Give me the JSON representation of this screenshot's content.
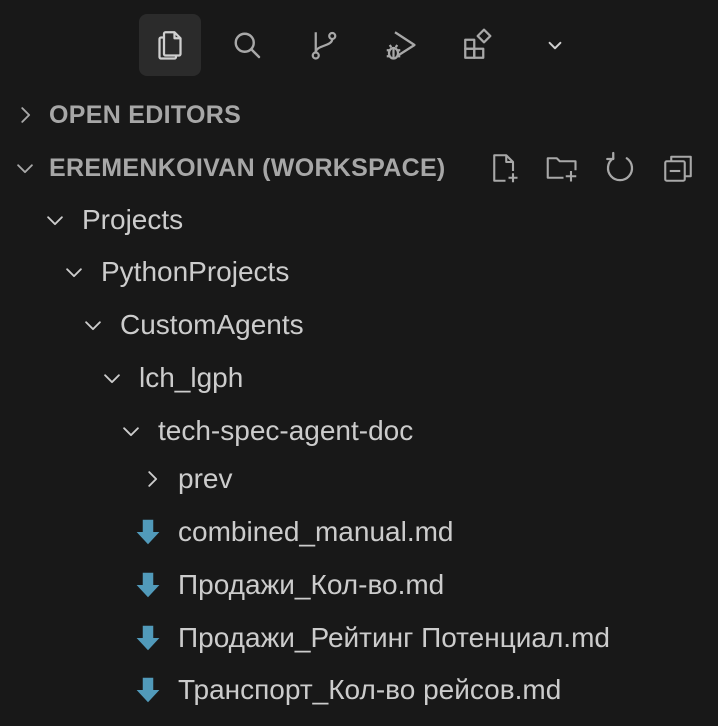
{
  "activity_bar": {
    "items": [
      {
        "name": "explorer",
        "icon": "files-icon",
        "active": true
      },
      {
        "name": "search",
        "icon": "search-icon",
        "active": false
      },
      {
        "name": "source-control",
        "icon": "git-branch-icon",
        "active": false
      },
      {
        "name": "run-and-debug",
        "icon": "run-debug-icon",
        "active": false
      },
      {
        "name": "extensions",
        "icon": "extensions-icon",
        "active": false
      },
      {
        "name": "more",
        "icon": "chevron-down-icon",
        "active": false
      }
    ]
  },
  "sections": {
    "open_editors": {
      "title": "OPEN EDITORS",
      "expanded": false
    },
    "workspace": {
      "title": "EREMENKOIVAN (WORKSPACE)",
      "expanded": true
    }
  },
  "workspace_actions": [
    {
      "name": "new-file",
      "icon": "new-file-icon"
    },
    {
      "name": "new-folder",
      "icon": "new-folder-icon"
    },
    {
      "name": "refresh",
      "icon": "refresh-icon"
    },
    {
      "name": "collapse-all",
      "icon": "collapse-all-icon"
    }
  ],
  "tree": [
    {
      "label": "Projects",
      "type": "folder",
      "expanded": true,
      "depth": 0
    },
    {
      "label": "PythonProjects",
      "type": "folder",
      "expanded": true,
      "depth": 1
    },
    {
      "label": "CustomAgents",
      "type": "folder",
      "expanded": true,
      "depth": 2
    },
    {
      "label": "lch_lgph",
      "type": "folder",
      "expanded": true,
      "depth": 3
    },
    {
      "label": "tech-spec-agent-doc",
      "type": "folder",
      "expanded": true,
      "depth": 4
    },
    {
      "label": "prev",
      "type": "folder",
      "expanded": false,
      "depth": 5
    },
    {
      "label": "combined_manual.md",
      "type": "file",
      "depth": 5
    },
    {
      "label": "Продажи_Кол-во.md",
      "type": "file",
      "depth": 5
    },
    {
      "label": "Продажи_Рейтинг Потенциал.md",
      "type": "file",
      "depth": 5
    },
    {
      "label": "Транспорт_Кол-во рейсов.md",
      "type": "file",
      "depth": 5
    }
  ],
  "colors": {
    "background": "#181818",
    "active_bg": "#2b2b2b",
    "text": "#cccccc",
    "header_text": "#a7a7a7",
    "icon": "#a8a8a8",
    "md_icon": "#519aba"
  }
}
